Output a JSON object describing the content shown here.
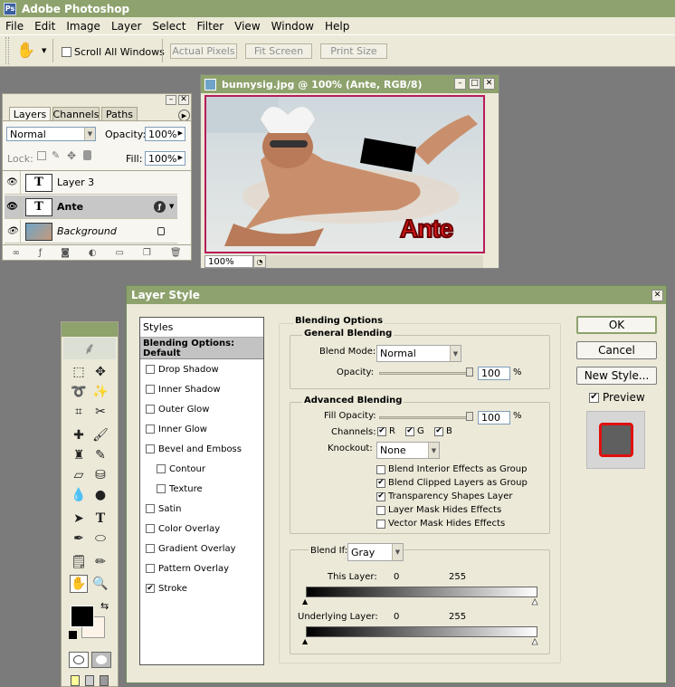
{
  "app": {
    "title": "Adobe Photoshop",
    "logo": "Ps"
  },
  "menu": [
    "File",
    "Edit",
    "Image",
    "Layer",
    "Select",
    "Filter",
    "View",
    "Window",
    "Help"
  ],
  "options": {
    "scroll_all": "Scroll All Windows",
    "actual_pixels": "Actual Pixels",
    "fit_screen": "Fit Screen",
    "print_size": "Print Size"
  },
  "layers_palette": {
    "tabs": [
      "Layers",
      "Channels",
      "Paths"
    ],
    "blend_mode": "Normal",
    "opacity_label": "Opacity:",
    "opacity": "100%",
    "lock_label": "Lock:",
    "fill_label": "Fill:",
    "fill": "100%",
    "layers": [
      {
        "name": "Layer 3",
        "type": "text"
      },
      {
        "name": "Ante",
        "type": "text",
        "selected": true
      },
      {
        "name": "Background",
        "type": "image",
        "italic": true
      }
    ]
  },
  "image_window": {
    "title": "bunnysig.jpg @ 100% (Ante, RGB/8)",
    "zoom": "100%",
    "overlay_text": "Ante"
  },
  "dialog": {
    "title": "Layer Style",
    "styles_header": "Styles",
    "items": [
      {
        "label": "Blending Options: Default",
        "checkbox": false,
        "bold": true
      },
      {
        "label": "Drop Shadow",
        "checkbox": true,
        "checked": false
      },
      {
        "label": "Inner Shadow",
        "checkbox": true,
        "checked": false
      },
      {
        "label": "Outer Glow",
        "checkbox": true,
        "checked": false
      },
      {
        "label": "Inner Glow",
        "checkbox": true,
        "checked": false
      },
      {
        "label": "Bevel and Emboss",
        "checkbox": true,
        "checked": false
      },
      {
        "label": "Contour",
        "checkbox": true,
        "checked": false,
        "indent": true
      },
      {
        "label": "Texture",
        "checkbox": true,
        "checked": false,
        "indent": true
      },
      {
        "label": "Satin",
        "checkbox": true,
        "checked": false
      },
      {
        "label": "Color Overlay",
        "checkbox": true,
        "checked": false
      },
      {
        "label": "Gradient Overlay",
        "checkbox": true,
        "checked": false
      },
      {
        "label": "Pattern Overlay",
        "checkbox": true,
        "checked": false
      },
      {
        "label": "Stroke",
        "checkbox": true,
        "checked": true
      }
    ],
    "blending_options": "Blending Options",
    "general": {
      "title": "General Blending",
      "blend_mode_label": "Blend Mode:",
      "blend_mode": "Normal",
      "opacity_label": "Opacity:",
      "opacity": "100",
      "pct": "%"
    },
    "advanced": {
      "title": "Advanced Blending",
      "fill_label": "Fill Opacity:",
      "fill": "100",
      "pct": "%",
      "channels_label": "Channels:",
      "channels": [
        "R",
        "G",
        "B"
      ],
      "knockout_label": "Knockout:",
      "knockout": "None",
      "options": [
        {
          "label": "Blend Interior Effects as Group",
          "checked": false
        },
        {
          "label": "Blend Clipped Layers as Group",
          "checked": true
        },
        {
          "label": "Transparency Shapes Layer",
          "checked": true
        },
        {
          "label": "Layer Mask Hides Effects",
          "checked": false
        },
        {
          "label": "Vector Mask Hides Effects",
          "checked": false
        }
      ]
    },
    "blend_if": {
      "label": "Blend If:",
      "value": "Gray",
      "this_layer": "This Layer:",
      "underlying": "Underlying Layer:",
      "min": "0",
      "max": "255"
    },
    "buttons": {
      "ok": "OK",
      "cancel": "Cancel",
      "new_style": "New Style...",
      "preview": "Preview"
    }
  },
  "colors": {
    "title_bar": "#8ea26d",
    "dialog_bg": "#ece9d8",
    "stroke_red": "#e01010",
    "ante_red": "#e01818"
  }
}
